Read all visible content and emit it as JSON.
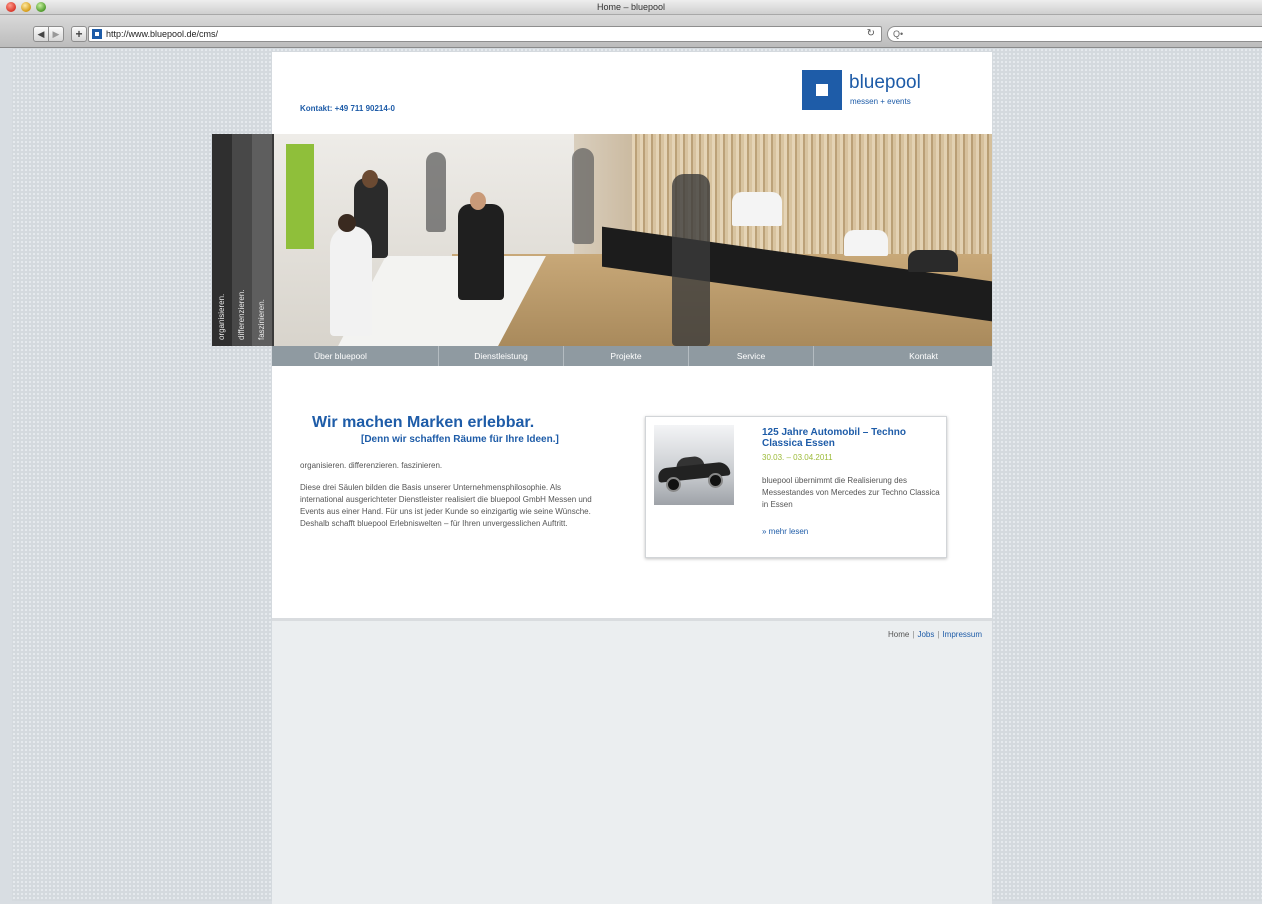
{
  "browser": {
    "window_title": "Home – bluepool",
    "url": "http://www.bluepool.de/cms/",
    "back_icon": "◀",
    "forward_icon": "▶",
    "add_icon": "+",
    "reload_icon": "↻",
    "search_icon": "Q•"
  },
  "header": {
    "contact": "Kontakt: +49 711 90214-0",
    "logo_name": "bluepool",
    "logo_sub": "messen + events"
  },
  "hero": {
    "stripes": [
      "organisieren.",
      "differenzieren.",
      "faszinieren."
    ]
  },
  "nav": {
    "items": [
      "Über bluepool",
      "Dienstleistung",
      "Projekte",
      "Service",
      "Kontakt"
    ]
  },
  "main": {
    "headline": "Wir machen Marken erlebbar.",
    "subheadline": "[Denn wir schaffen Räume für Ihre Ideen.]",
    "pillars": "organisieren. differenzieren. faszinieren.",
    "body": "Diese drei Säulen bilden die Basis unserer Unternehmensphilosophie. Als international ausgerichteter Dienstleister realisiert die bluepool GmbH Messen und Events aus einer Hand. Für uns ist jeder Kunde so einzigartig wie seine Wünsche. Deshalb schafft bluepool Erlebniswelten – für Ihren unvergesslichen Auftritt."
  },
  "news": {
    "title": "125 Jahre Automobil – Techno Classica Essen",
    "date": "30.03. – 03.04.2011",
    "text": "bluepool übernimmt die Realisierung des Messestandes von Mercedes zur Techno Classica in Essen",
    "more": "» mehr lesen"
  },
  "footer": {
    "home": "Home",
    "jobs": "Jobs",
    "impressum": "Impressum",
    "separator": "|"
  },
  "colors": {
    "brand_blue": "#1e5ca8",
    "date_green": "#9dbb3a",
    "nav_gray": "#8f9aa1"
  }
}
